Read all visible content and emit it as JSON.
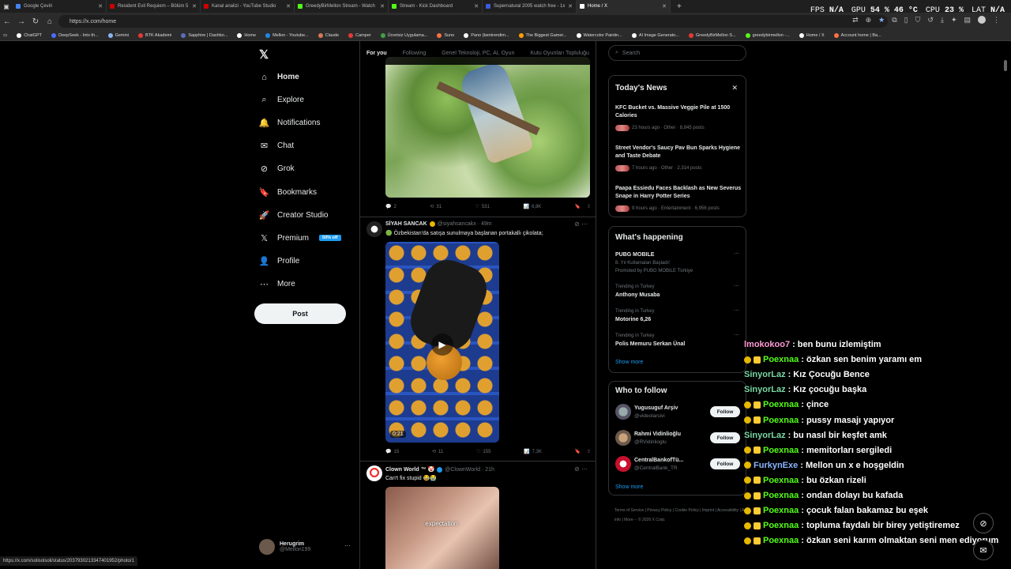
{
  "browser": {
    "tabs": [
      {
        "title": "Google Çeviri",
        "color": "#4285f4"
      },
      {
        "title": "Resident Evil Requiem – Bölüm 5",
        "color": "#cc0000"
      },
      {
        "title": "Kanal analizi - YouTube Studio",
        "color": "#cc0000"
      },
      {
        "title": "GreedyBirMellon Stream - Watch",
        "color": "#53fc18"
      },
      {
        "title": "Stream - Kick Dashboard",
        "color": "#53fc18"
      },
      {
        "title": "Supernatural 2005 watch free - 1x",
        "color": "#3b5bdb"
      },
      {
        "title": "Home / X",
        "color": "#ffffff"
      }
    ],
    "new_tab": "+",
    "url": "https://x.com/home",
    "perf": {
      "fps_label": "FPS",
      "fps": "N/A",
      "gpu_label": "GPU",
      "gpu": "54 % 46 °C",
      "cpu_label": "CPU",
      "cpu": "23 %",
      "lat_label": "LAT",
      "lat": "N/A"
    },
    "bookmarks": [
      {
        "label": "ChatGPT",
        "color": "#ffffff"
      },
      {
        "label": "DeepSeek - Into th...",
        "color": "#4d6bfe"
      },
      {
        "label": "Gemini",
        "color": "#8ab4f8"
      },
      {
        "label": "BTK Akademi",
        "color": "#e53935"
      },
      {
        "label": "Sapphire | Dashbo...",
        "color": "#5c6bc0"
      },
      {
        "label": "Home",
        "color": "#ffffff"
      },
      {
        "label": "Mellon - Youtube...",
        "color": "#1e88e5"
      },
      {
        "label": "Claude",
        "color": "#d97757"
      },
      {
        "label": "Camper",
        "color": "#e53935"
      },
      {
        "label": "Ücretsiz Uygulama...",
        "color": "#43a047"
      },
      {
        "label": "Suno",
        "color": "#ff7043"
      },
      {
        "label": "Pano (bentrendim...",
        "color": "#ffffff"
      },
      {
        "label": "The Biggest Gamer...",
        "color": "#ffa000"
      },
      {
        "label": "Watercolor Paintin...",
        "color": "#ffffff"
      },
      {
        "label": "AI Image Generato...",
        "color": "#ffffff"
      },
      {
        "label": "GreedyBirMellon S...",
        "color": "#e53935"
      },
      {
        "label": "greedybirmellon -...",
        "color": "#53fc18"
      },
      {
        "label": "Home / X",
        "color": "#ffffff"
      },
      {
        "label": "Account home | Ba...",
        "color": "#ff7043"
      }
    ],
    "status_url": "https://x.com/solisolsoli/status/2037930213347401952/photo/1"
  },
  "nav": {
    "logo": "𝕏",
    "items": [
      {
        "label": "Home",
        "icon": "home-icon",
        "glyph": "⌂"
      },
      {
        "label": "Explore",
        "icon": "search-icon",
        "glyph": "⌕"
      },
      {
        "label": "Notifications",
        "icon": "bell-icon",
        "glyph": "🔔"
      },
      {
        "label": "Chat",
        "icon": "mail-icon",
        "glyph": "✉"
      },
      {
        "label": "Grok",
        "icon": "grok-icon",
        "glyph": "⊘"
      },
      {
        "label": "Bookmarks",
        "icon": "bookmark-icon",
        "glyph": "🔖"
      },
      {
        "label": "Creator Studio",
        "icon": "rocket-icon",
        "glyph": "🚀"
      },
      {
        "label": "Premium",
        "icon": "x-logo-icon",
        "glyph": "𝕏"
      },
      {
        "label": "Profile",
        "icon": "person-icon",
        "glyph": "👤"
      },
      {
        "label": "More",
        "icon": "more-circle-icon",
        "glyph": "⋯"
      }
    ],
    "premium_badge": "50% off",
    "post_label": "Post",
    "profile": {
      "name": "Herugrim",
      "handle": "@Mellon199"
    }
  },
  "feed": {
    "tabs": [
      "For you",
      "Following",
      "Genel Teknoloji, PC, AI, Oyun",
      "Kutu Oyunları Topluluğu"
    ],
    "tweet1_actions": {
      "replies": "2",
      "reposts": "31",
      "likes": "531",
      "views": "6,8K"
    },
    "tweet2": {
      "name": "SİYAH SANCAK",
      "handle": "@siyahsancakx · 49m",
      "text": "🟢 Özbekistan'da satışa sunulmaya başlanan portakallı çikolata;",
      "video_time": "0:21",
      "actions": {
        "replies": "15",
        "reposts": "11",
        "likes": "155",
        "views": "7,3K"
      }
    },
    "tweet3": {
      "name": "Clown World ™ 🤡",
      "handle": "@ClownWorld · 21h",
      "text": "Can't fix stupid 😂😭",
      "caption": "expectation:"
    }
  },
  "right": {
    "search_placeholder": "Search",
    "news_title": "Today's News",
    "news": [
      {
        "title": "KFC Bucket vs. Massive Veggie Pile at 1500 Calories",
        "meta": "23 hours ago · Other · 8,845 posts"
      },
      {
        "title": "Street Vendor's Saucy Pav Bun Sparks Hygiene and Taste Debate",
        "meta": "7 hours ago · Other · 2,314 posts"
      },
      {
        "title": "Paapa Essiedu Faces Backlash as New Severus Snape in Harry Potter Series",
        "meta": "9 hours ago · Entertainment · 6,956 posts"
      }
    ],
    "happening_title": "What's happening",
    "trends": [
      {
        "context": "8. Yıl Kutlamaları Başladı!",
        "name": "PUBG MOBILE",
        "extra": "Promoted by PUBG MOBILE Türkiye"
      },
      {
        "context": "Trending in Turkey",
        "name": "Anthony Musaba"
      },
      {
        "context": "Trending in Turkey",
        "name": "Motorine 6,26"
      },
      {
        "context": "Trending in Turkey",
        "name": "Polis Memuru Serkan Ünal"
      }
    ],
    "show_more": "Show more",
    "who_title": "Who to follow",
    "who": [
      {
        "name": "Yugusuguf Arşiv",
        "handle": "@videolarsivi",
        "follow": "Follow"
      },
      {
        "name": "Rahmi Vidinlioğlu",
        "handle": "@RVidinlioglu",
        "follow": "Follow"
      },
      {
        "name": "CentralBankofTü...",
        "handle": "@CentralBank_TR",
        "follow": "Follow"
      }
    ],
    "footer": "Terms of Service  |  Privacy Policy  |  Cookie Policy  |  Imprint  |  Accessibility  |  Ads info  |  More···  © 2026 X Corp."
  },
  "chat": [
    {
      "user": "lmokokoo7",
      "text": ": ben bunu izlemiştim",
      "color": "#ff9ad5",
      "badges": 0
    },
    {
      "user": "Poexnaa",
      "text": ": özkan sen benim yaramı em",
      "color": "#53fc18",
      "badges": 2
    },
    {
      "user": "SinyorLaz",
      "text": ": Kız Çocuğu Bence",
      "color": "#7ad7a2",
      "badges": 0
    },
    {
      "user": "SinyorLaz",
      "text": ": Kız çocuğu başka",
      "color": "#7ad7a2",
      "badges": 0
    },
    {
      "user": "Poexnaa",
      "text": ": çince",
      "color": "#53fc18",
      "badges": 2
    },
    {
      "user": "Poexnaa",
      "text": ": pussy masajı yapıyor",
      "color": "#53fc18",
      "badges": 2
    },
    {
      "user": "SinyorLaz",
      "text": ": bu nasıl bir keşfet amk",
      "color": "#7ad7a2",
      "badges": 0
    },
    {
      "user": "Poexnaa",
      "text": ": memitorları sergiledi",
      "color": "#53fc18",
      "badges": 2
    },
    {
      "user": "FurkynExe",
      "text": ": Mellon un x e hoşgeldin",
      "color": "#8ab4ff",
      "badges": 1
    },
    {
      "user": "Poexnaa",
      "text": ": bu özkan rizeli",
      "color": "#53fc18",
      "badges": 2
    },
    {
      "user": "Poexnaa",
      "text": ": ondan dolayı bu kafada",
      "color": "#53fc18",
      "badges": 2
    },
    {
      "user": "Poexnaa",
      "text": ": çocuk falan bakamaz bu eşek",
      "color": "#53fc18",
      "badges": 2
    },
    {
      "user": "Poexnaa",
      "text": ": topluma faydalı bir birey yetiştiremez",
      "color": "#53fc18",
      "badges": 2
    },
    {
      "user": "Poexnaa",
      "text": ": özkan seni karım olmaktan seni men ediyorum",
      "color": "#53fc18",
      "badges": 2
    }
  ]
}
